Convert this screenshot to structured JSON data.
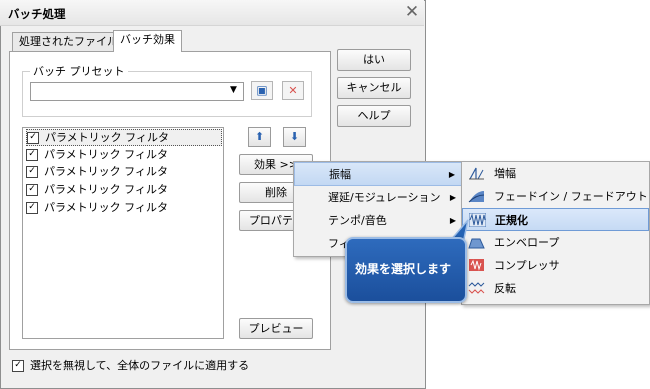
{
  "dialog": {
    "title": "バッチ処理"
  },
  "tabs": [
    {
      "label": "処理されたファイル"
    },
    {
      "label": "バッチ効果"
    }
  ],
  "preset": {
    "group_label": "バッチ プリセット",
    "value": ""
  },
  "effects": [
    {
      "label": "パラメトリック フィルタ",
      "checked": true,
      "selected": true
    },
    {
      "label": "パラメトリック フィルタ",
      "checked": true
    },
    {
      "label": "パラメトリック フィルタ",
      "checked": true
    },
    {
      "label": "パラメトリック フィルタ",
      "checked": true
    },
    {
      "label": "パラメトリック フィルタ",
      "checked": true
    }
  ],
  "buttons": {
    "ok": "はい",
    "cancel": "キャンセル",
    "help": "ヘルプ",
    "effects": "効果 >>",
    "delete": "削除",
    "properties": "プロパティ",
    "preview": "プレビュー"
  },
  "footer": {
    "apply_all_label": "選択を無視して、全体のファイルに適用する",
    "checked": true
  },
  "menu": {
    "items": [
      {
        "label": "振幅",
        "submenu": true
      },
      {
        "label": "遅延/モジュレーション",
        "submenu": true
      },
      {
        "label": "テンポ/音色",
        "submenu": true
      },
      {
        "label": "フィ"
      }
    ],
    "submenu_items": [
      {
        "label": "増幅",
        "icon": "amplify-icon"
      },
      {
        "label": "フェードイン / フェードアウト",
        "icon": "fade-icon"
      },
      {
        "label": "正規化",
        "icon": "normalize-icon"
      },
      {
        "label": "エンベロープ",
        "icon": "envelope-icon"
      },
      {
        "label": "コンプレッサ",
        "icon": "compressor-icon"
      },
      {
        "label": "反転",
        "icon": "invert-icon"
      }
    ]
  },
  "callout": {
    "text": "効果を選択します"
  },
  "colors": {
    "accent": "#1f57a4",
    "highlight": "#c6daf4"
  }
}
